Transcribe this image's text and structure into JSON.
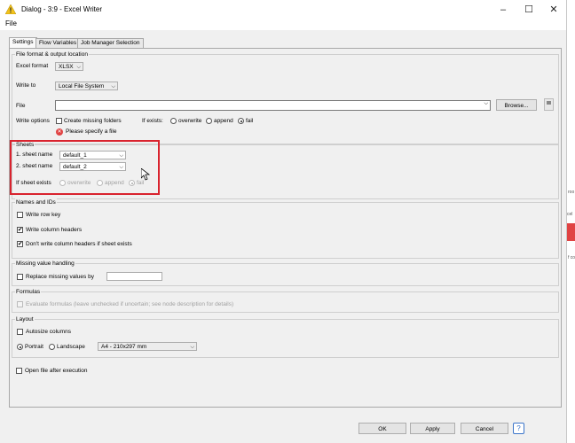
{
  "window": {
    "title": "Dialog - 3:9 - Excel Writer",
    "menu_file": "File",
    "controls": {
      "minimize": "–",
      "maximize": "☐",
      "close": "✕"
    }
  },
  "tabs": [
    {
      "label": "Settings",
      "active": true
    },
    {
      "label": "Flow Variables",
      "active": false
    },
    {
      "label": "Job Manager Selection",
      "active": false
    }
  ],
  "file_format": {
    "legend": "File format & output location",
    "excel_format_label": "Excel format",
    "excel_format_value": "XLSX",
    "write_to_label": "Write to",
    "write_to_value": "Local File System",
    "file_label": "File",
    "file_value": "",
    "browse_label": "Browse...",
    "write_options_label": "Write options",
    "create_missing_folders_label": "Create missing folders",
    "create_missing_folders_checked": false,
    "if_exists_label": "If exists:",
    "if_exists_options": [
      "overwrite",
      "append",
      "fail"
    ],
    "if_exists_selected": "fail",
    "error_text": "Please specify a file"
  },
  "sheets": {
    "legend": "Sheets",
    "sheet1_label": "1. sheet name",
    "sheet1_value": "default_1",
    "sheet2_label": "2. sheet name",
    "sheet2_value": "default_2",
    "if_sheet_exists_label": "If sheet exists",
    "options": [
      "overwrite",
      "append",
      "fail"
    ],
    "selected": "fail"
  },
  "names_ids": {
    "legend": "Names and IDs",
    "write_row_key": "Write row key",
    "write_column_headers": "Write column headers",
    "dont_write_headers": "Don't write column headers if sheet exists"
  },
  "missing": {
    "legend": "Missing value handling",
    "replace_label": "Replace missing values by",
    "replace_value": ""
  },
  "formulas": {
    "legend": "Formulas",
    "evaluate_label": "Evaluate formulas (leave unchecked if uncertain; see node description for details)"
  },
  "layout": {
    "legend": "Layout",
    "autosize_label": "Autosize columns",
    "portrait_label": "Portrait",
    "landscape_label": "Landscape",
    "paper_value": "A4 - 210x297 mm"
  },
  "open_after_label": "Open file after execution",
  "buttons": {
    "ok": "OK",
    "apply": "Apply",
    "cancel": "Cancel",
    "help": "?"
  },
  "colors": {
    "highlight": "#d9232e",
    "error": "#e04343",
    "accent": "#3a74c9"
  }
}
